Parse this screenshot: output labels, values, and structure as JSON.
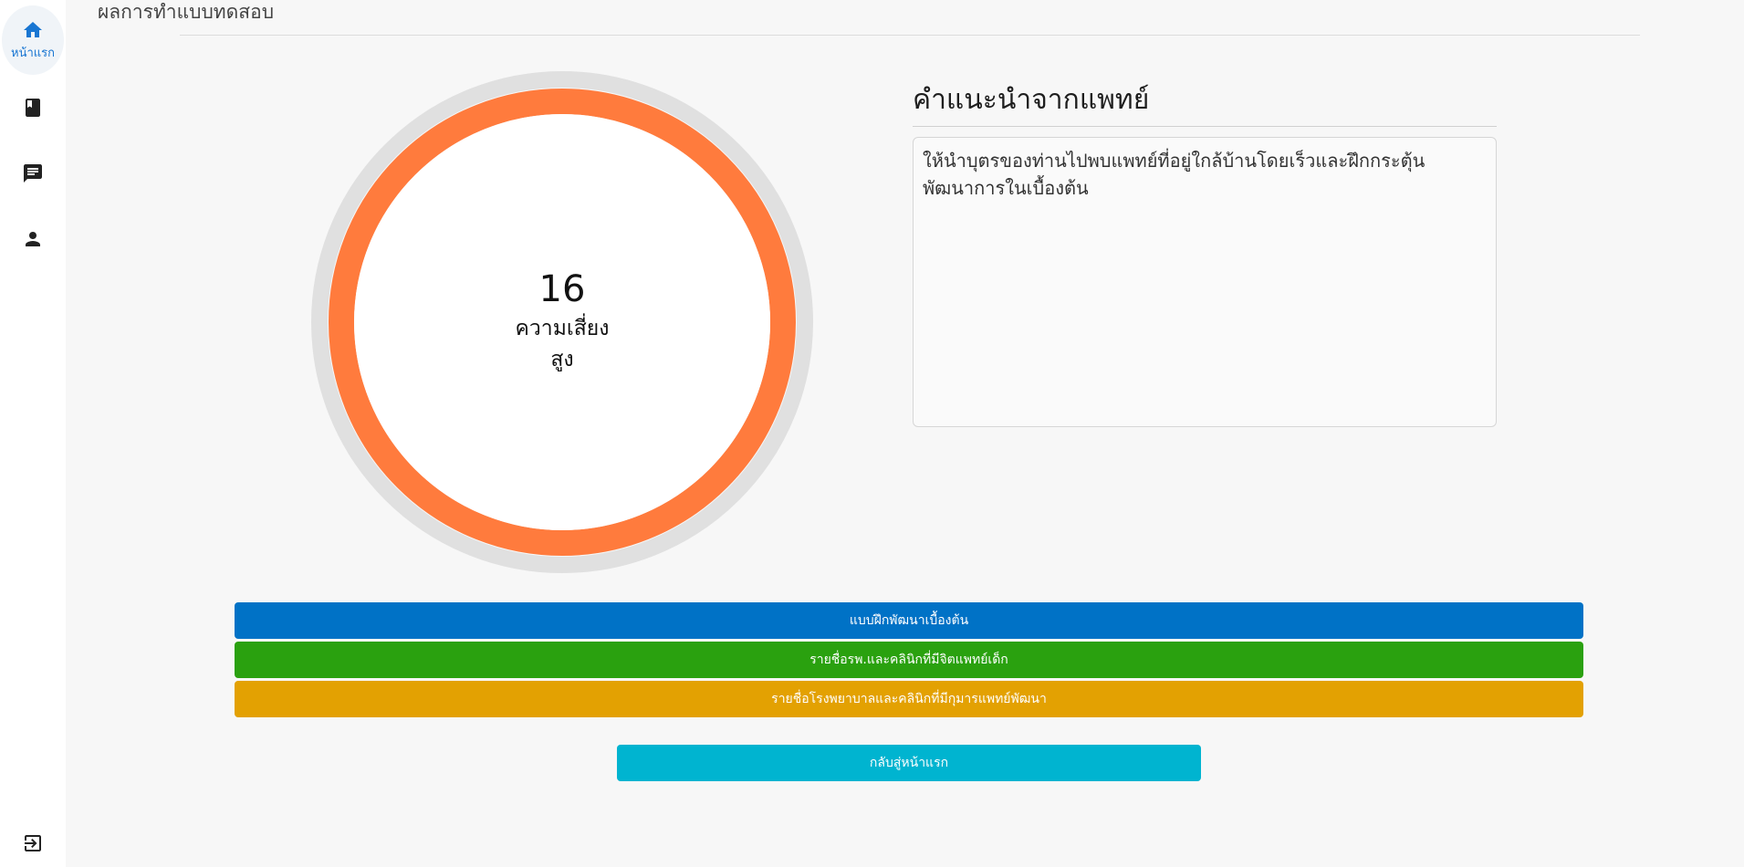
{
  "page": {
    "title": "ผลการทำแบบทดสอบ"
  },
  "sidebar": {
    "home_label": "หน้าแรก",
    "items": [
      {
        "icon": "home-icon"
      },
      {
        "icon": "book-icon"
      },
      {
        "icon": "chat-icon"
      },
      {
        "icon": "person-icon"
      },
      {
        "icon": "logout-icon"
      }
    ]
  },
  "result": {
    "score": "16",
    "score_value": 16,
    "progress_fraction": 1.0,
    "risk_line1": "ความเสี่ยง",
    "risk_line2": "สูง",
    "ring_color": "#ff7b3d",
    "track_color": "#e0e0e0"
  },
  "advice": {
    "title": "คำแนะนำจากแพทย์",
    "text": "ให้นำบุตรของท่านไปพบแพทย์ที่อยู่ใกล้บ้านโดยเร็วและฝึกกระตุ้นพัฒนาการในเบื้องต้น"
  },
  "buttons": {
    "training": "แบบฝึกพัฒนาเบื้องต้น",
    "child_psychiatrist": "รายชื่อรพ.และคลินิกที่มีจิตแพทย์เด็ก",
    "pediatric_dev": "รายชื่อโรงพยาบาลและคลินิกที่มีกุมารแพทย์พัฒนา",
    "back_home": "กลับสู่หน้าแรก"
  },
  "colors": {
    "primary": "#0072c6",
    "success": "#2aa10f",
    "warning": "#e3a102",
    "info": "#00b4d0",
    "accent": "#1976d2"
  }
}
